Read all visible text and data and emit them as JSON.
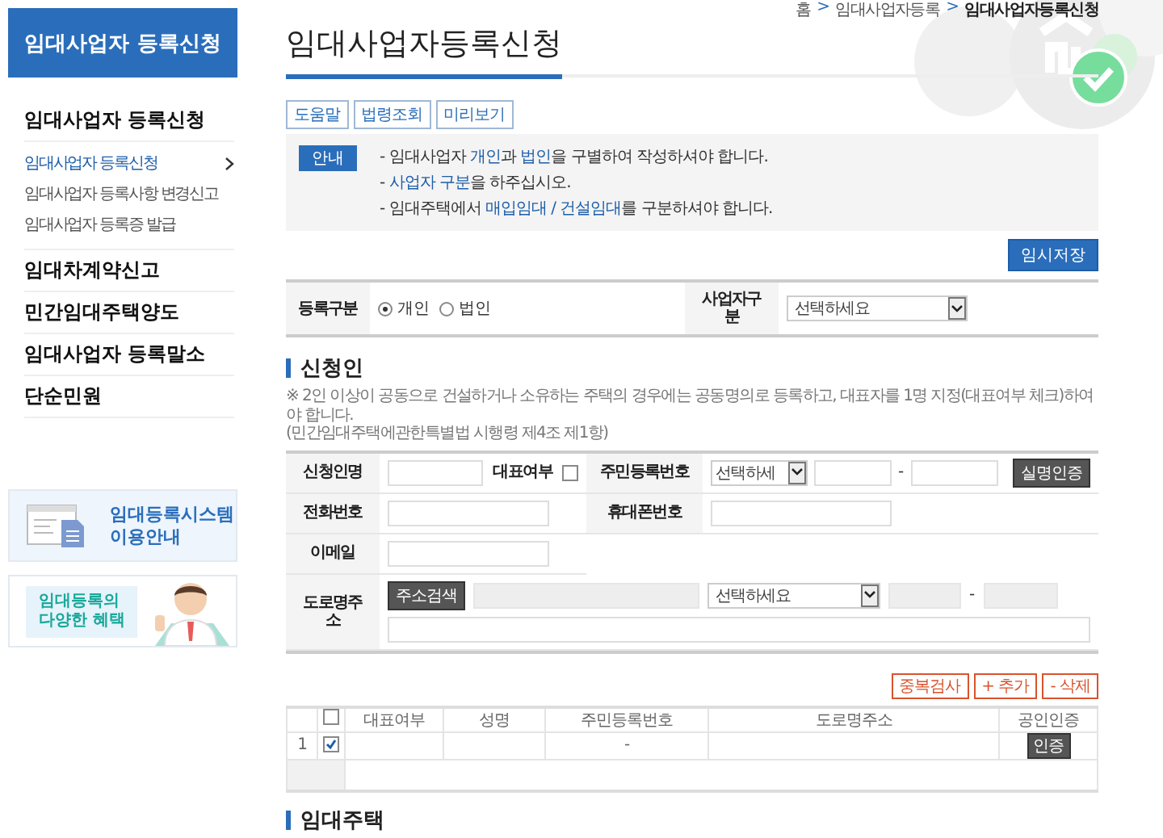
{
  "sidebar": {
    "title": "임대사업자 등록신청",
    "sections": [
      {
        "label": "임대사업자 등록신청",
        "children": [
          {
            "label": "임대사업자 등록신청",
            "selected": true
          },
          {
            "label": "임대사업자 등록사항 변경신고",
            "selected": false
          },
          {
            "label": "임대사업자 등록증 발급",
            "selected": false
          }
        ]
      },
      {
        "label": "임대차계약신고"
      },
      {
        "label": "민간임대주택양도"
      },
      {
        "label": "임대사업자 등록말소"
      },
      {
        "label": "단순민원"
      }
    ],
    "banners": [
      {
        "kind": "guide",
        "lines": [
          "임대등록시스템",
          "이용안내"
        ]
      },
      {
        "kind": "benefit",
        "lines": [
          "임대등록의",
          "다양한 혜택"
        ]
      }
    ]
  },
  "breadcrumb": {
    "separator": ">",
    "items": [
      "홈",
      "임대사업자등록",
      "임대사업자등록신청"
    ]
  },
  "page_title": "임대사업자등록신청",
  "tool_buttons": [
    "도움말",
    "법령조회",
    "미리보기"
  ],
  "notice": {
    "badge": "안내",
    "lines": [
      "- 임대사업자 **개인**과 **법인**을 구별하여 작성하셔야 합니다.",
      "- **사업자 구분**을 하주십시오.",
      "- 임대주택에서 **매입임대 / 건설임대**를 구분하셔야 합니다."
    ]
  },
  "save_button": "임시저장",
  "registration": {
    "type_label": "등록구분",
    "options": [
      {
        "label": "개인",
        "selected": true
      },
      {
        "label": "법인",
        "selected": false
      }
    ],
    "business_label": "사업자구분",
    "business_select": "선택하세요"
  },
  "applicant": {
    "heading": "신청인",
    "notes": [
      "※ 2인 이상이 공동으로 건설하거나 소유하는 주택의 경우에는 공동명의로 등록하고, 대표자를 1명 지정(대표여부 체크)하여야 합니다.",
      "(민간임대주택에관한특별법 시행령 제4조 제1항)"
    ],
    "name_label": "신청인명",
    "representative": {
      "label": "대표여부",
      "checked": false
    },
    "rrn_label": "주민등록번호",
    "rrn_select": "선택하세",
    "rrn_dash": "-",
    "verify_button": "실명인증",
    "phone_label": "전화번호",
    "mobile_label": "휴대폰번호",
    "email_label": "이메일",
    "address_label": "도로명주소",
    "address_search": "주소검색",
    "address_select": "선택하세요",
    "address_dash": "-"
  },
  "list": {
    "select_all_checked": false,
    "buttons": [
      "중복검사",
      "+ 추가",
      "- 삭제"
    ],
    "columns": [
      "대표여부",
      "성명",
      "주민등록번호",
      "도로명주소",
      "공인인증"
    ],
    "rows": [
      {
        "number": "1",
        "checked": true,
        "rrn": "-",
        "cert_button": "인증"
      }
    ]
  },
  "next_heading": "임대주택"
}
